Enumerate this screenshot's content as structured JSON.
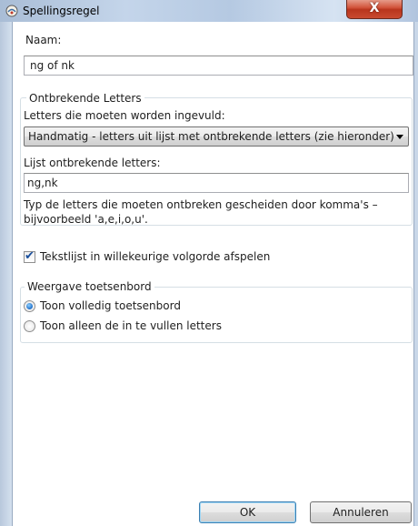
{
  "window": {
    "title": "Spellingsregel",
    "close_glyph": "X"
  },
  "name_field": {
    "label": "Naam:",
    "value": "ng of nk"
  },
  "missing_letters_group": {
    "legend": "Ontbrekende Letters",
    "mode_label": "Letters die moeten worden ingevuld:",
    "mode_selected": "Handmatig - letters uit lijst met ontbrekende letters (zie hieronder)",
    "list_label": "Lijst ontbrekende letters:",
    "list_value": "ng,nk",
    "hint": "Typ de letters die moeten ontbreken gescheiden door komma's – bijvoorbeeld 'a,e,i,o,u'."
  },
  "random_order": {
    "label": "Tekstlijst in willekeurige volgorde afspelen",
    "checked": true
  },
  "keyboard_group": {
    "legend": "Weergave toetsenbord",
    "options": [
      {
        "label": "Toon volledig toetsenbord",
        "selected": true
      },
      {
        "label": "Toon alleen de in te vullen letters",
        "selected": false
      }
    ]
  },
  "buttons": {
    "ok": "OK",
    "cancel": "Annuleren"
  }
}
